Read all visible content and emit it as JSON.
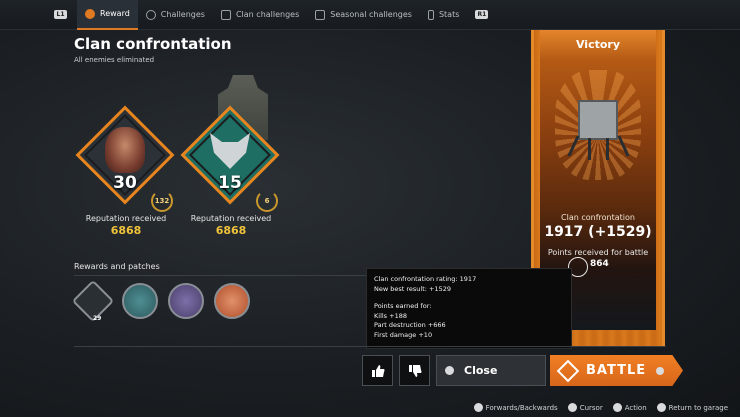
{
  "nav": {
    "left_hint": "L1",
    "right_hint": "R1",
    "tabs": [
      {
        "label": "Reward",
        "active": true
      },
      {
        "label": "Challenges",
        "active": false
      },
      {
        "label": "Clan challenges",
        "active": false
      },
      {
        "label": "Seasonal challenges",
        "active": false
      },
      {
        "label": "Stats",
        "active": false
      }
    ]
  },
  "header": {
    "title": "Clan confrontation",
    "subtitle": "All enemies eliminated"
  },
  "players": [
    {
      "level": "30",
      "badge": "132",
      "rep_label": "Reputation received",
      "rep_value": "6868"
    },
    {
      "level": "15",
      "badge": "6",
      "rep_label": "Reputation received",
      "rep_value": "6868"
    }
  ],
  "rewards": {
    "title": "Rewards and patches",
    "first_count": "29"
  },
  "banner": {
    "result": "Victory",
    "label": "Clan confrontation",
    "points": "1917 (+1529)",
    "received_label": "Points received for battle",
    "received_value": "864"
  },
  "tooltip": {
    "rating": "Clan confrontation rating: 1917",
    "best": "New best result: +1529",
    "earned_title": "Points earned for:",
    "kills": "Kills +188",
    "parts": "Part destruction +666",
    "first": "First damage +10"
  },
  "buttons": {
    "close": "Close",
    "battle": "BATTLE"
  },
  "footer": {
    "forwards": "Forwards/Backwards",
    "cursor": "Cursor",
    "action": "Action",
    "return": "Return to garage"
  },
  "colors": {
    "accent": "#e07a22",
    "gold": "#f0c23a",
    "banner": "#d9791c"
  }
}
